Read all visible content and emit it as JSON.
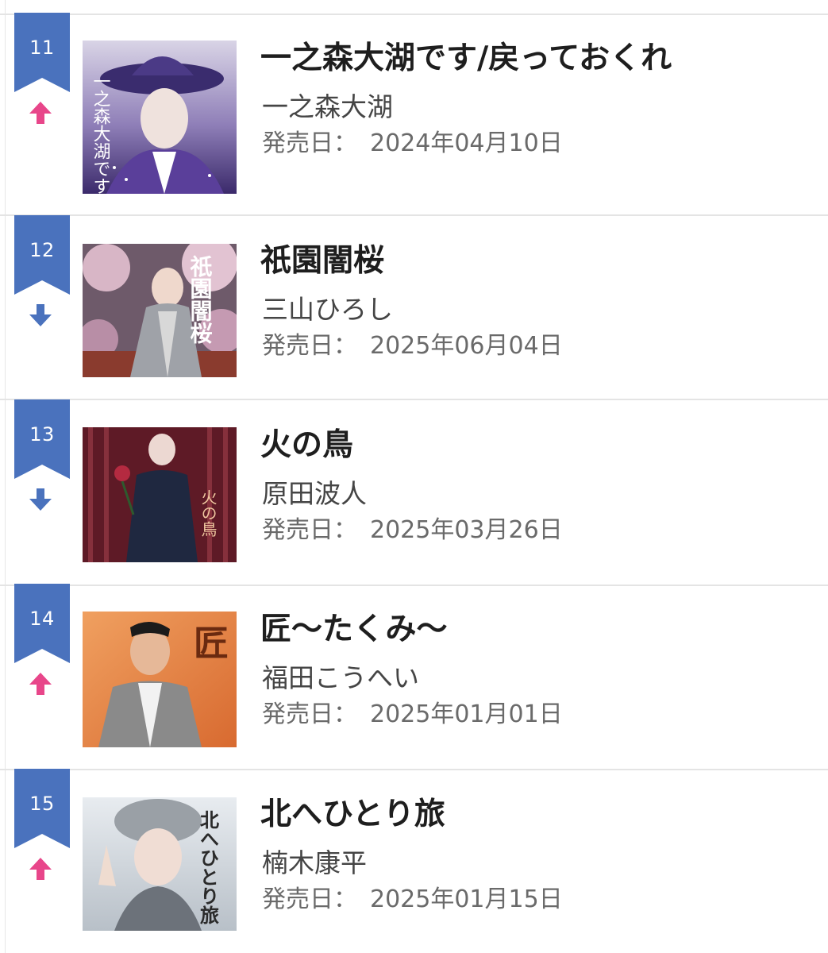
{
  "ranking": {
    "items": [
      {
        "rank": "11",
        "trend": "up",
        "title": "一之森大湖です/戻っておくれ",
        "artist": "一之森大湖",
        "release_label": "発売日：",
        "release_date": "2024年04月10日",
        "cover_text": "一之森大湖です"
      },
      {
        "rank": "12",
        "trend": "down",
        "title": "祇園闇桜",
        "artist": "三山ひろし",
        "release_label": "発売日：",
        "release_date": "2025年06月04日",
        "cover_text": "祇園闇桜"
      },
      {
        "rank": "13",
        "trend": "down",
        "title": "火の鳥",
        "artist": "原田波人",
        "release_label": "発売日：",
        "release_date": "2025年03月26日",
        "cover_text": "火の鳥"
      },
      {
        "rank": "14",
        "trend": "up",
        "title": "匠〜たくみ〜",
        "artist": "福田こうへい",
        "release_label": "発売日：",
        "release_date": "2025年01月01日",
        "cover_text": "匠"
      },
      {
        "rank": "15",
        "trend": "up",
        "title": "北へひとり旅",
        "artist": "楠木康平",
        "release_label": "発売日：",
        "release_date": "2025年01月15日",
        "cover_text": "北へひとり旅"
      }
    ]
  },
  "colors": {
    "ribbon": "#4a72bd",
    "trend_up": "#e8468a",
    "trend_down": "#4a72bd",
    "divider": "#e4e4e4"
  },
  "icons": {
    "trend_up": "arrow-up-icon",
    "trend_down": "arrow-down-icon",
    "rank": "rank-ribbon-icon"
  }
}
